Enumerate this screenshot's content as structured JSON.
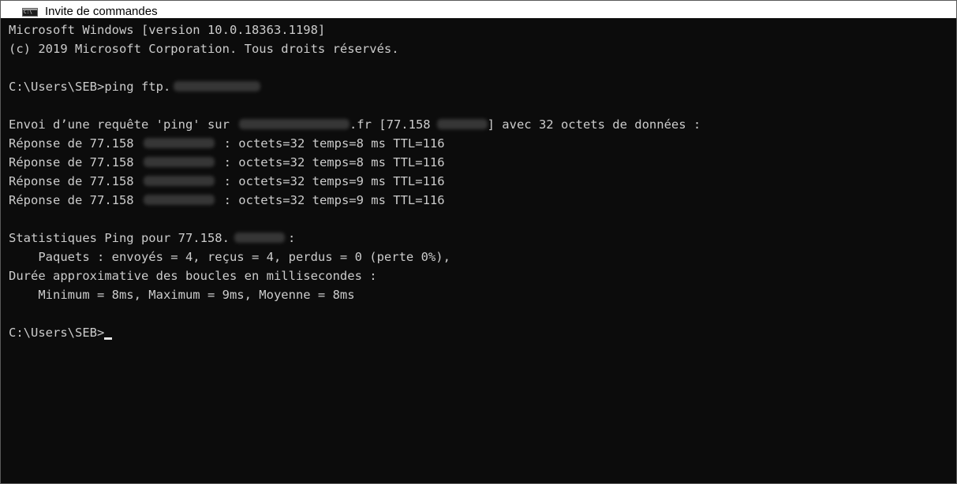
{
  "window": {
    "title": "Invite de commandes",
    "icon": "console-icon",
    "icon_text": "C:\\"
  },
  "console": {
    "lines": [
      "Microsoft Windows [version 10.0.18363.1198]",
      "(c) 2019 Microsoft Corporation. Tous droits réservés.",
      "",
      "C:\\Users\\SEB>ping ftp.",
      "",
      "Envoi d’une requête 'ping' sur",
      ".fr [77.158",
      "] avec 32 octets de données :",
      "Réponse de 77.158",
      ": octets=32 temps=8 ms TTL=116",
      "Réponse de 77.158",
      ": octets=32 temps=8 ms TTL=116",
      "Réponse de 77.158",
      ": octets=32 temps=9 ms TTL=116",
      "Réponse de 77.158",
      ": octets=32 temps=9 ms TTL=116",
      "Statistiques Ping pour 77.158.",
      ":",
      "    Paquets : envoyés = 4, reçus = 4, perdus = 0 (perte 0%),",
      "Durée approximative des boucles en millisecondes :",
      "    Minimum = 8ms, Maximum = 9ms, Moyenne = 8ms",
      "C:\\Users\\SEB>"
    ]
  }
}
